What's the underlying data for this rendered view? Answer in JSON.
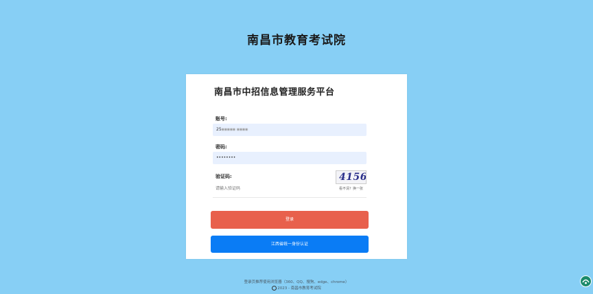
{
  "header": {
    "site_title": "南昌市教育考试院"
  },
  "login_card": {
    "title": "南昌市中招信息管理服务平台",
    "account_label": "账号:",
    "account_value": "25",
    "password_label": "密码:",
    "password_value": "••••••••",
    "captcha_label": "验证码:",
    "captcha_placeholder": "请输入验证码",
    "captcha_code": "4156",
    "captcha_refresh_text": "看不清？换一张",
    "login_button_label": "登录",
    "id_auth_button_label": "江西省统一身份认证"
  },
  "footer": {
    "browser_notice": "登录页推荐使用浏览器（360、QQ、搜狗、edge、chrome）",
    "copyright": "2023 - 南昌市教育考试院"
  },
  "colors": {
    "background": "#87cff5",
    "input_bg": "#e8f0fe",
    "login_button": "#e8604c",
    "id_auth_button": "#0a7cf5"
  },
  "icons": {
    "copyright": "copyright-icon",
    "floating": "help-logo-icon"
  }
}
